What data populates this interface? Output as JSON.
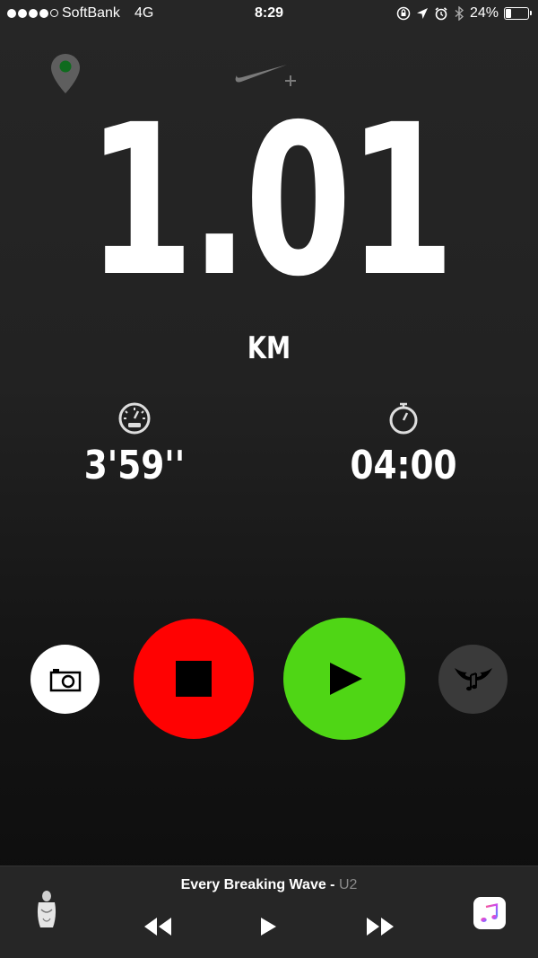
{
  "status_bar": {
    "carrier": "SoftBank",
    "network": "4G",
    "time": "8:29",
    "battery_percent": "24%",
    "battery_level": 0.24,
    "signal_bars_filled": 4,
    "signal_bars_total": 5
  },
  "run": {
    "distance": "1.01",
    "distance_unit": "KM",
    "pace": "3'59''",
    "duration": "04:00"
  },
  "now_playing": {
    "title": "Every Breaking Wave",
    "separator": " - ",
    "artist": "U2"
  },
  "icons": {
    "location": "location-pin-icon",
    "brand": "nike-plus-logo",
    "pace": "speedometer-icon",
    "duration": "stopwatch-icon",
    "camera": "camera-icon",
    "stop": "stop-icon",
    "play": "play-icon",
    "powersong": "winged-music-note-icon",
    "rewind": "rewind-icon",
    "fast_forward": "fast-forward-icon",
    "music_app": "music-app-icon"
  },
  "colors": {
    "stop_button": "#ff0202",
    "play_button": "#4fd615",
    "camera_button": "#ffffff",
    "powersong_button": "#3a3a3a",
    "gps_indicator": "#0f6b1e"
  }
}
